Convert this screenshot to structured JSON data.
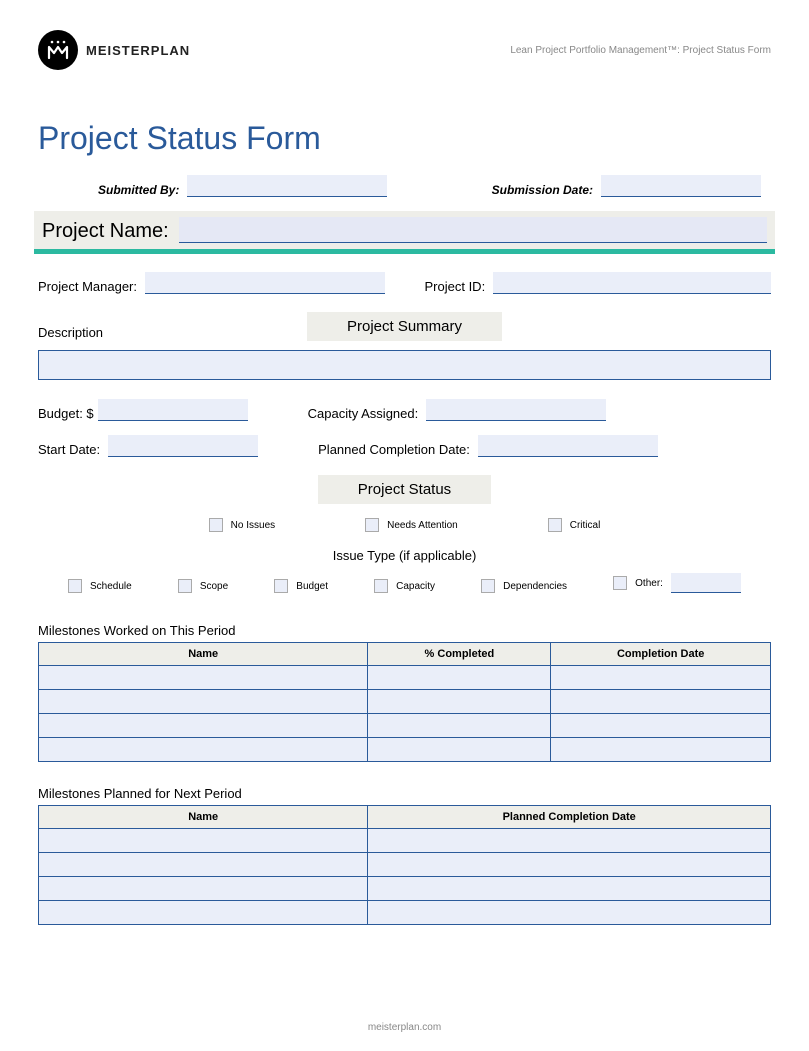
{
  "header": {
    "brand": "MEISTERPLAN",
    "tagline": "Lean Project Portfolio Management™: Project Status Form"
  },
  "title": "Project Status Form",
  "submission": {
    "submitted_by_label": "Submitted By:",
    "submitted_by_value": "",
    "submission_date_label": "Submission Date:",
    "submission_date_value": ""
  },
  "project_name": {
    "label": "Project Name:",
    "value": ""
  },
  "meta": {
    "manager_label": "Project Manager:",
    "manager_value": "",
    "id_label": "Project ID:",
    "id_value": ""
  },
  "summary": {
    "heading": "Project Summary",
    "description_label": "Description",
    "description_value": "",
    "budget_label": "Budget:  $",
    "budget_value": "",
    "capacity_label": "Capacity Assigned:",
    "capacity_value": "",
    "start_label": "Start Date:",
    "start_value": "",
    "planned_label": "Planned Completion Date:",
    "planned_value": ""
  },
  "status": {
    "heading": "Project Status",
    "opts": {
      "no_issues": "No Issues",
      "needs_attention": "Needs Attention",
      "critical": "Critical"
    },
    "issue_heading": "Issue Type (if applicable)",
    "issues": {
      "schedule": "Schedule",
      "scope": "Scope",
      "budget": "Budget",
      "capacity": "Capacity",
      "dependencies": "Dependencies",
      "other": "Other:",
      "other_value": ""
    }
  },
  "milestones_worked": {
    "title": "Milestones Worked on This Period",
    "cols": {
      "name": "Name",
      "pct": "% Completed",
      "date": "Completion Date"
    },
    "rows": [
      {
        "name": "",
        "pct": "",
        "date": ""
      },
      {
        "name": "",
        "pct": "",
        "date": ""
      },
      {
        "name": "",
        "pct": "",
        "date": ""
      },
      {
        "name": "",
        "pct": "",
        "date": ""
      }
    ]
  },
  "milestones_planned": {
    "title": "Milestones Planned for Next Period",
    "cols": {
      "name": "Name",
      "date": "Planned Completion Date"
    },
    "rows": [
      {
        "name": "",
        "date": ""
      },
      {
        "name": "",
        "date": ""
      },
      {
        "name": "",
        "date": ""
      },
      {
        "name": "",
        "date": ""
      }
    ]
  },
  "footer": "meisterplan.com"
}
